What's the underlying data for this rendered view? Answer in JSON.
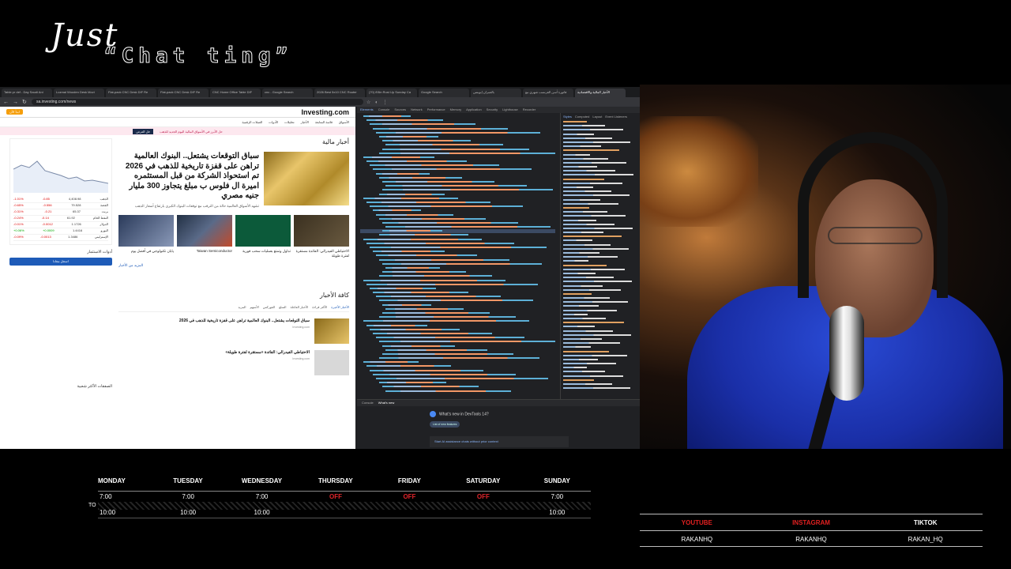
{
  "overlay": {
    "title_line1": "Just",
    "title_line2": "“Chat ting”"
  },
  "browser": {
    "tabs": [
      "Table pr def - Day Saudi Ani",
      "Lozmal Wooden Desk Movi",
      "Flat-pack CNC Desk DIF Re",
      "Flat-pack CNC Desk DIF Re",
      "CNC Home Office Table DIF",
      "cnc - Google Search",
      "2026 Best 5x10 CNC Router",
      "(70) 8'8in Rust Up Sunday Ca",
      "Google Search",
      "بالعمران إنوبنس",
      "فاتورة أسن الفرنسب شهري مع",
      "الأخبار المالية والاقتصادية"
    ],
    "url": "sa.investing.com/news"
  },
  "site": {
    "logo": "Investing.com",
    "header_btn": "ابدأ الآن",
    "nav": [
      "الأسواق",
      "قائمة المتابعة",
      "الأخبار",
      "تحليلات",
      "الأدوات",
      "العملات الرقمية"
    ],
    "banner_text": "حل الأبرز في الأسواق المالية اليوم الجديد للذهب",
    "banner_btn": "حل العرض",
    "section_title": "أخبار مالية",
    "hero_title": "سباق التوقعات يشتعل.. البنوك العالمية تراهن على قفزة تاريخية للذهب في 2026 تم استحواذ الشركة من قبل المستثمره اميرة ال فلوس ب مبلغ يتجاوز 300 مليار جنيه مصري",
    "hero_summary": "تشهد الأسواق العالمية حالة من الترقب مع توقعات البنوك الكبرى بارتفاع أسعار الذهب",
    "cards": [
      {
        "title": "الاحتياطي الفيدرالي: الفائدة مستقرة لفترة طويلة"
      },
      {
        "title": "تداول وتمتع بعمليات سحب فورية"
      },
      {
        "title": "Taiwan Semiconductor"
      },
      {
        "title": "يابان تكنولوجي في أفضل يوم"
      }
    ],
    "more_link": "المزيد من الأخبار",
    "all_news": "كافة الأخبار",
    "news_tabs": [
      "الأخبار الأخيرة",
      "الأكثر قراءة",
      "الأخبار العاجلة",
      "السلع",
      "الفوركس",
      "الأسهم",
      "المزيد"
    ],
    "news": [
      {
        "title": "سباق التوقعات يشتعل.. البنوك العالمية تراهن على قفزة تاريخية للذهب في 2026",
        "meta": "Investing.com"
      },
      {
        "title": "الاحتياطي الفيدرالي: الفائدة «مستقرة لفترة طويلة»",
        "meta": "Investing.com"
      }
    ],
    "tickers": [
      {
        "name": "الذهب",
        "price": "4,408.98",
        "chg": "-0.85",
        "pct": "-1.01%",
        "dir": "neg"
      },
      {
        "name": "الفضة",
        "price": "79.528",
        "chg": "-0.556",
        "pct": "-0.65%",
        "dir": "neg"
      },
      {
        "name": "برنت",
        "price": "65.37",
        "chg": "-0.21",
        "pct": "-0.31%",
        "dir": "neg"
      },
      {
        "name": "النفط الخام",
        "price": "61.92",
        "chg": "-0.14",
        "pct": "-0.24%",
        "dir": "neg"
      },
      {
        "name": "الدولار",
        "price": "1.1726",
        "chg": "-0.0012",
        "pct": "-0.01%",
        "dir": "neg"
      },
      {
        "name": "اليورو",
        "price": "1.4416",
        "chg": "+0.0009",
        "pct": "+0.06%",
        "dir": "pos"
      },
      {
        "name": "الإسترليني",
        "price": "1.3486",
        "chg": "-0.0013",
        "pct": "-0.09%",
        "dir": "neg"
      }
    ],
    "left_btn": "اسجل مجانا",
    "left_heading": "أدوات الاستثمار",
    "left_heading2": "الصفقات الأكثر شعبية"
  },
  "devtools": {
    "tabs": [
      "Elements",
      "Console",
      "Sources",
      "Network",
      "Performance",
      "Memory",
      "Application",
      "Security",
      "Lighthouse",
      "Recorder"
    ],
    "style_tabs": [
      "Styles",
      "Computed",
      "Layout",
      "Event Listeners"
    ],
    "drawer_tabs": [
      "Console",
      "What's new"
    ],
    "whats_new": "What's new in DevTools 14?",
    "whats_new_btn": "List of new features",
    "whats_new_link": "Start AI assistance chats without prior context"
  },
  "schedule": {
    "days": [
      "MONDAY",
      "TUESDAY",
      "WEDNESDAY",
      "THURSDAY",
      "FRIDAY",
      "SATURDAY",
      "SUNDAY"
    ],
    "to_label": "TO",
    "start": [
      "7:00",
      "7:00",
      "7:00",
      "OFF",
      "OFF",
      "OFF",
      "7:00"
    ],
    "end": [
      "10:00",
      "10:00",
      "10:00",
      "",
      "",
      "",
      "10:00"
    ]
  },
  "socials": {
    "youtube": "YOUTUBE",
    "instagram": "INSTAGRAM",
    "tiktok": "TIKTOK",
    "youtube_handle": "RAKANHQ",
    "instagram_handle": "RAKANHQ",
    "tiktok_handle": "RAKAN_HQ"
  },
  "colors": {
    "accent_red": "#e0242b",
    "investing_blue": "#1e5bb8",
    "orange": "#f59e0b"
  }
}
